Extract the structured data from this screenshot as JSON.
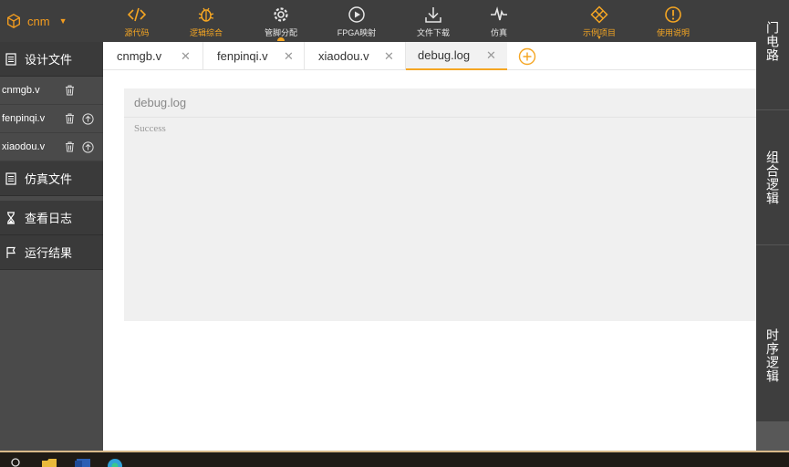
{
  "brand": {
    "name": "cnm"
  },
  "toolbar": {
    "items": [
      {
        "label": "源代码",
        "icon": "code-icon",
        "color": "#f5a623"
      },
      {
        "label": "逻辑综合",
        "icon": "bug-icon",
        "color": "#f5a623"
      },
      {
        "label": "管脚分配",
        "icon": "gear-icon",
        "color": "#e6e6e6"
      },
      {
        "label": "FPGA映射",
        "icon": "play-icon",
        "color": "#e6e6e6"
      },
      {
        "label": "文件下载",
        "icon": "download-icon",
        "color": "#e6e6e6"
      },
      {
        "label": "仿真",
        "icon": "waveform-icon",
        "color": "#e6e6e6"
      },
      {
        "label": "示例项目",
        "icon": "diamond-grid-icon",
        "color": "#f5a623"
      },
      {
        "label": "使用说明",
        "icon": "info-circle-icon",
        "color": "#f5a623"
      }
    ]
  },
  "sidebar": {
    "design_files": "设计文件",
    "files": [
      {
        "name": "cnmgb.v"
      },
      {
        "name": "fenpinqi.v"
      },
      {
        "name": "xiaodou.v"
      }
    ],
    "sim_files": "仿真文件",
    "view_log": "查看日志",
    "run_result": "运行结果"
  },
  "right_panel": {
    "items": [
      "门电路",
      "组合逻辑",
      "时序逻辑"
    ]
  },
  "tabs": [
    {
      "label": "cnmgb.v",
      "active": false
    },
    {
      "label": "fenpinqi.v",
      "active": false
    },
    {
      "label": "xiaodou.v",
      "active": false
    },
    {
      "label": "debug.log",
      "active": true
    }
  ],
  "log": {
    "title": "debug.log",
    "content": "Success"
  },
  "colors": {
    "accent": "#f5a623",
    "toolbar_bg": "#3e3e3e",
    "sidebar_bg": "#4a4a4a"
  }
}
